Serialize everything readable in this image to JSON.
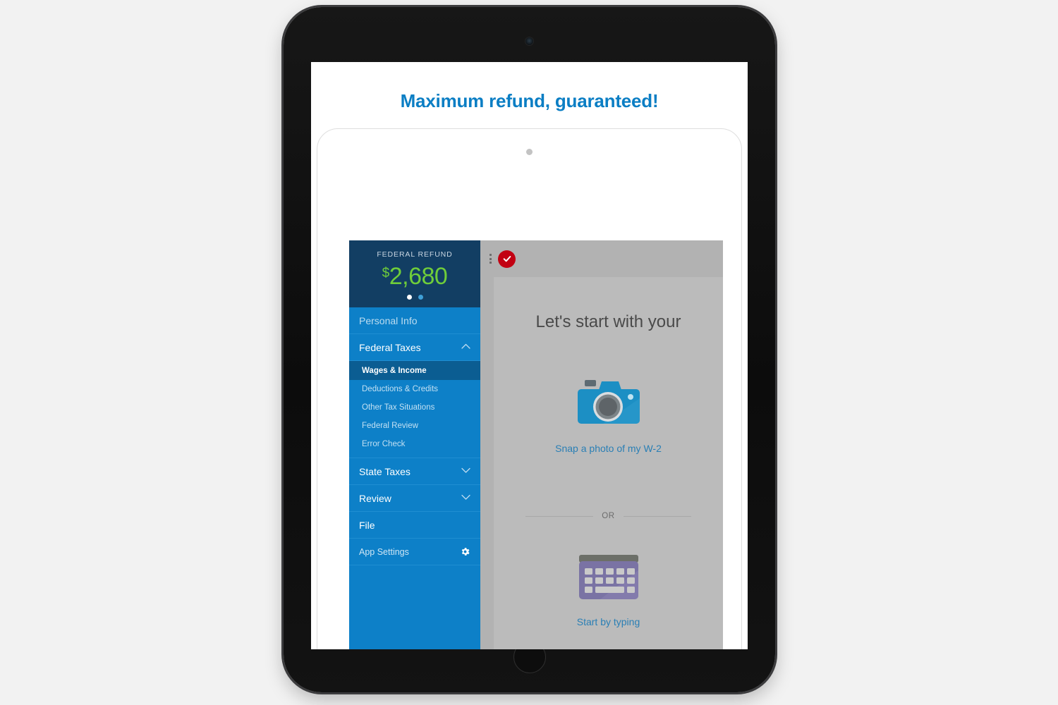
{
  "promo": {
    "title": "Maximum refund, guaranteed!"
  },
  "sidebar": {
    "refund": {
      "label": "FEDERAL REFUND",
      "currency": "$",
      "amount": "2,680",
      "pager": {
        "active_index": 0,
        "count": 2
      }
    },
    "items": [
      {
        "label": "Personal Info",
        "state": "muted",
        "chevron": ""
      },
      {
        "label": "Federal Taxes",
        "state": "expanded",
        "chevron": "chevron-up-icon"
      },
      {
        "label": "State Taxes",
        "state": "collapsed",
        "chevron": "chevron-down-icon"
      },
      {
        "label": "Review",
        "state": "collapsed",
        "chevron": "chevron-down-icon"
      },
      {
        "label": "File",
        "state": "plain",
        "chevron": ""
      }
    ],
    "federal_taxes_subitems": [
      {
        "label": "Wages & Income",
        "selected": true
      },
      {
        "label": "Deductions & Credits",
        "selected": false
      },
      {
        "label": "Other Tax Situations",
        "selected": false
      },
      {
        "label": "Federal Review",
        "selected": false
      },
      {
        "label": "Error Check",
        "selected": false
      }
    ],
    "settings": {
      "label": "App Settings",
      "icon": "gear-icon"
    }
  },
  "toolbar": {
    "menu_icon": "kebab-menu-icon",
    "status_icon": "red-check-badge-icon"
  },
  "main": {
    "heading": "Let's start with your",
    "options": [
      {
        "icon": "camera-icon",
        "label": "Snap a photo of my W-2"
      },
      {
        "icon": "keyboard-icon",
        "label": "Start by typing"
      }
    ],
    "divider_text": "OR"
  },
  "colors": {
    "brand_blue": "#0d80c8",
    "header_navy": "#123e63",
    "refund_green": "#6fcd3a",
    "promo_blue": "#0b7ec4",
    "badge_red": "#c20012",
    "link_blue": "#2a7fb5",
    "content_gray": "#bbbbbb"
  },
  "device": {
    "frame": "tablet-frame",
    "home_button": "home-button",
    "camera": "front-camera"
  }
}
